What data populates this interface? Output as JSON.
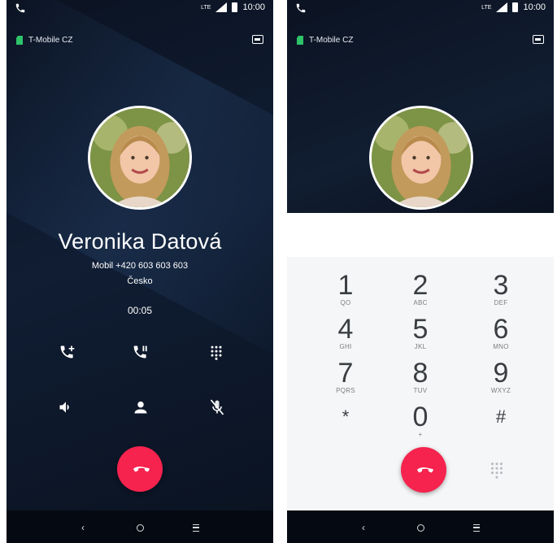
{
  "left_screen": {
    "status": {
      "time": "10:00",
      "network": "LTE"
    },
    "carrier": "T-Mobile CZ",
    "contact": {
      "name": "Veronika Datová",
      "number": "Mobil +420 603 603 603",
      "country": "Česko"
    },
    "timer": "00:05",
    "controls": [
      "add-call-icon",
      "hold-icon",
      "keypad-icon",
      "speaker-icon",
      "contact-icon",
      "mute-icon"
    ],
    "end_call_icon": "end-call-icon",
    "nav": {
      "back": "‹"
    }
  },
  "right_screen": {
    "status": {
      "time": "10:00",
      "network": "LTE"
    },
    "carrier": "T-Mobile CZ",
    "keys": [
      {
        "digit": "1",
        "letters": "QO"
      },
      {
        "digit": "2",
        "letters": "ABC"
      },
      {
        "digit": "3",
        "letters": "DEF"
      },
      {
        "digit": "4",
        "letters": "GHI"
      },
      {
        "digit": "5",
        "letters": "JKL"
      },
      {
        "digit": "6",
        "letters": "MNO"
      },
      {
        "digit": "7",
        "letters": "PQRS"
      },
      {
        "digit": "8",
        "letters": "TUV"
      },
      {
        "digit": "9",
        "letters": "WXYZ"
      },
      {
        "digit": "*",
        "letters": ""
      },
      {
        "digit": "0",
        "letters": "+"
      },
      {
        "digit": "#",
        "letters": ""
      }
    ],
    "nav": {
      "back": "‹"
    }
  },
  "colors": {
    "end_call": "#f5234e",
    "sim": "#2fc36a",
    "dark_bg": "#0d1626"
  }
}
